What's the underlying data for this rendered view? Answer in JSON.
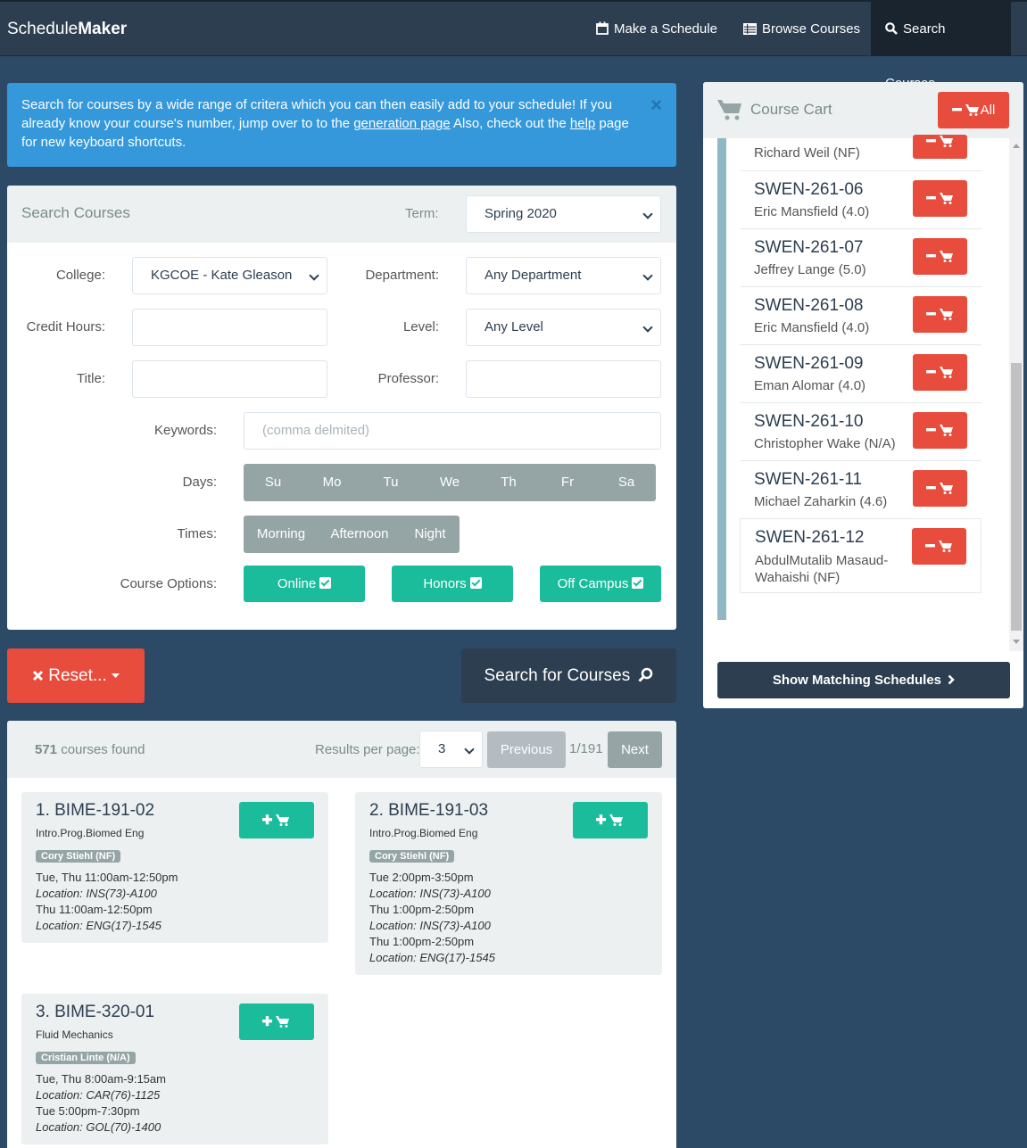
{
  "nav": {
    "brand_plain": "Schedule",
    "brand_bold": "Maker",
    "items": [
      {
        "label": "Make a Schedule",
        "icon": "calendar-icon"
      },
      {
        "label": "Browse Courses",
        "icon": "list-icon"
      },
      {
        "label": "Search Courses",
        "icon": "search-icon",
        "active": true
      }
    ]
  },
  "alert": {
    "text1": "Search for courses by a wide range of critera which you can then easily add to your schedule! If you already know your course's number, jump over to to the ",
    "link1": "generation page",
    "text2": " Also, check out the ",
    "link2": "help",
    "text3": " page for new keyboard shortcuts.",
    "close": "×"
  },
  "search": {
    "title": "Search Courses",
    "term_label": "Term:",
    "term_value": "Spring 2020",
    "college_label": "College:",
    "college_value": "KGCOE - Kate Gleason",
    "department_label": "Department:",
    "department_value": "Any Department",
    "credit_label": "Credit Hours:",
    "credit_value": "",
    "level_label": "Level:",
    "level_value": "Any Level",
    "title_label": "Title:",
    "title_value": "",
    "professor_label": "Professor:",
    "professor_value": "",
    "keywords_label": "Keywords:",
    "keywords_placeholder": "(comma delmited)",
    "days_label": "Days:",
    "days": [
      "Su",
      "Mo",
      "Tu",
      "We",
      "Th",
      "Fr",
      "Sa"
    ],
    "times_label": "Times:",
    "times": [
      "Morning",
      "Afternoon",
      "Night"
    ],
    "options_label": "Course Options:",
    "options": [
      "Online",
      "Honors",
      "Off Campus"
    ]
  },
  "actions": {
    "reset": "Reset...",
    "search": "Search for Courses"
  },
  "results": {
    "count": "571",
    "count_suffix": " courses found",
    "per_page_label": "Results per page:",
    "per_page": "3",
    "previous": "Previous",
    "page": "1/191",
    "next": "Next",
    "courses": [
      {
        "title": "1. BIME-191-02",
        "name": "Intro.Prog.Biomed Eng",
        "prof": "Cory Stiehl (NF)",
        "times": [
          {
            "t": "Tue, Thu 11:00am-12:50pm",
            "l": "Location: INS(73)-A100"
          },
          {
            "t": "Thu 11:00am-12:50pm",
            "l": "Location: ENG(17)-1545"
          }
        ]
      },
      {
        "title": "2. BIME-191-03",
        "name": "Intro.Prog.Biomed Eng",
        "prof": "Cory Stiehl (NF)",
        "times": [
          {
            "t": "Tue 2:00pm-3:50pm",
            "l": "Location: INS(73)-A100"
          },
          {
            "t": "Thu 1:00pm-2:50pm",
            "l": "Location: INS(73)-A100"
          },
          {
            "t": "Thu 1:00pm-2:50pm",
            "l": "Location: ENG(17)-1545"
          }
        ]
      },
      {
        "title": "3. BIME-320-01",
        "name": "Fluid Mechanics",
        "prof": "Cristian Linte (N/A)",
        "times": [
          {
            "t": "Tue, Thu 8:00am-9:15am",
            "l": "Location: CAR(76)-1125"
          },
          {
            "t": "Tue 5:00pm-7:30pm",
            "l": "Location: GOL(70)-1400"
          }
        ]
      }
    ]
  },
  "cart": {
    "title": "Course Cart",
    "all_label": "All",
    "partial_prof": "Richard Weil (NF)",
    "items": [
      {
        "course": "SWEN-261-06",
        "prof": "Eric Mansfield (4.0)"
      },
      {
        "course": "SWEN-261-07",
        "prof": "Jeffrey Lange (5.0)"
      },
      {
        "course": "SWEN-261-08",
        "prof": "Eric Mansfield (4.0)"
      },
      {
        "course": "SWEN-261-09",
        "prof": "Eman Alomar (4.0)"
      },
      {
        "course": "SWEN-261-10",
        "prof": "Christopher Wake (N/A)"
      },
      {
        "course": "SWEN-261-11",
        "prof": "Michael Zaharkin (4.6)"
      },
      {
        "course": "SWEN-261-12",
        "prof": "AbdulMutalib Masaud-Wahaishi (NF)"
      }
    ],
    "show_schedules": "Show Matching Schedules"
  },
  "colors": {
    "navbar": "#2c3e50",
    "body": "#2c4a66",
    "primary_info": "#3498db",
    "success": "#1abc9c",
    "danger": "#e74c3c",
    "gray": "#95a5a6"
  }
}
